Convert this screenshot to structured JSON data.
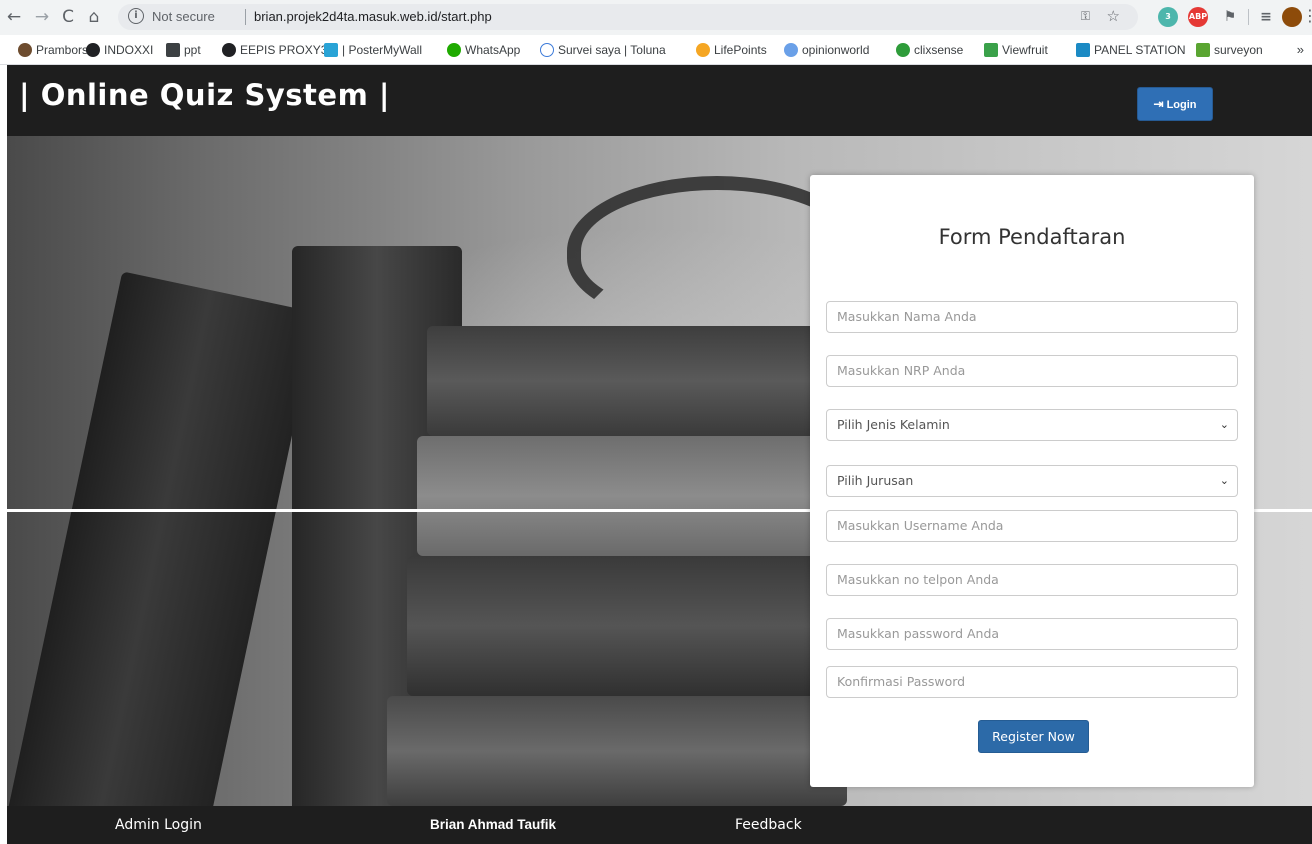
{
  "browser": {
    "security_label": "Not secure",
    "url": "brian.projek2d4ta.masuk.web.id/start.php",
    "nav_back_icon": "←",
    "nav_forward_icon": "→",
    "nav_reload_icon": "C",
    "nav_home_icon": "⌂",
    "ext_badge": "3",
    "ext_abp": "ABP",
    "bookmarks": [
      {
        "label": "Prambors",
        "color": "#6d4c2f"
      },
      {
        "label": "INDOXXI",
        "color": "#202124"
      },
      {
        "label": "ppt",
        "color": "#3c4043"
      },
      {
        "label": "EEPIS PROXY3",
        "color": "#202124"
      },
      {
        "label": "| PosterMyWall",
        "color": "#29a3d6"
      },
      {
        "label": "WhatsApp",
        "color": "#1faa00"
      },
      {
        "label": "Survei saya | Toluna",
        "color": "#3d7bd9"
      },
      {
        "label": "LifePoints",
        "color": "#f5a623"
      },
      {
        "label": "opinionworld",
        "color": "#6aa0e8"
      },
      {
        "label": "clixsense",
        "color": "#2e9c3a"
      },
      {
        "label": "Viewfruit",
        "color": "#3aa14a"
      },
      {
        "label": "PANEL STATION",
        "color": "#1b8ac4"
      },
      {
        "label": "surveyon",
        "color": "#5aa532"
      }
    ],
    "bookmarks_more": "»"
  },
  "header": {
    "title": "| Online Quiz System |",
    "login_label": "Login",
    "login_icon": "⇥"
  },
  "form": {
    "title": "Form Pendaftaran",
    "name_placeholder": "Masukkan Nama Anda",
    "nrp_placeholder": "Masukkan NRP Anda",
    "gender_selected": "Pilih Jenis Kelamin",
    "major_selected": "Pilih Jurusan",
    "username_placeholder": "Masukkan Username Anda",
    "phone_placeholder": "Masukkan no telpon Anda",
    "password_placeholder": "Masukkan password Anda",
    "confirm_placeholder": "Konfirmasi Password",
    "submit_label": "Register Now"
  },
  "footer": {
    "admin_login": "Admin Login",
    "author": "Brian Ahmad Taufik",
    "feedback": "Feedback"
  },
  "colors": {
    "header_bg": "#1e1e1e",
    "primary_button": "#2f6fb5"
  }
}
